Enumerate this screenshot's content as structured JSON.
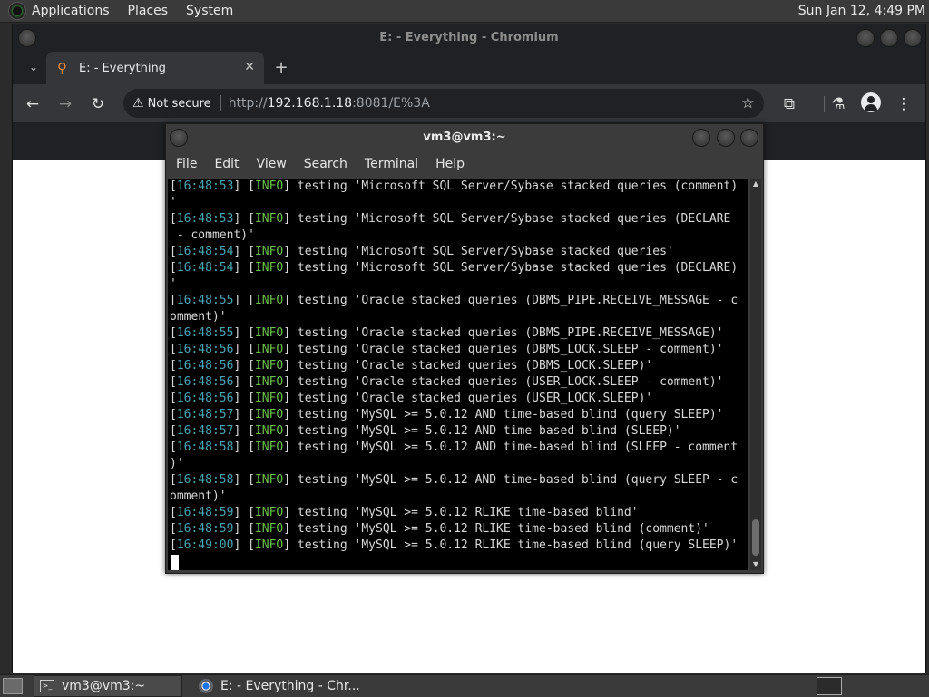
{
  "top_panel": {
    "menus": [
      "Applications",
      "Places",
      "System"
    ],
    "clock": "Sun Jan 12,  4:49 PM"
  },
  "browser": {
    "window_title": "E: - Everything - Chromium",
    "tab_title": "E: - Everything",
    "security_label": "Not secure",
    "url_prefix": "http://",
    "url_host": "192.168.1.18",
    "url_rest": ":8081/E%3A",
    "icons": {
      "tab_list": "chevron-down-icon",
      "favicon": "search-icon",
      "back": "back-arrow-icon",
      "forward": "forward-arrow-icon",
      "reload": "reload-icon",
      "warning": "warning-icon",
      "bookmark": "star-icon",
      "extensions": "puzzle-icon",
      "labs": "flask-icon",
      "profile": "avatar-icon",
      "menu": "kebab-menu-icon"
    }
  },
  "terminal": {
    "title": "vm3@vm3:~",
    "menu": [
      "File",
      "Edit",
      "View",
      "Search",
      "Terminal",
      "Help"
    ],
    "lines": [
      {
        "ts": "16:48:53",
        "lvl": "INFO",
        "msg": " testing 'Microsoft SQL Server/Sybase stacked queries (comment)"
      },
      {
        "ts": "",
        "lvl": "",
        "msg": "'"
      },
      {
        "ts": "16:48:53",
        "lvl": "INFO",
        "msg": " testing 'Microsoft SQL Server/Sybase stacked queries (DECLARE"
      },
      {
        "ts": "",
        "lvl": "",
        "msg": " - comment)'"
      },
      {
        "ts": "16:48:54",
        "lvl": "INFO",
        "msg": " testing 'Microsoft SQL Server/Sybase stacked queries'"
      },
      {
        "ts": "16:48:54",
        "lvl": "INFO",
        "msg": " testing 'Microsoft SQL Server/Sybase stacked queries (DECLARE)"
      },
      {
        "ts": "",
        "lvl": "",
        "msg": "'"
      },
      {
        "ts": "16:48:55",
        "lvl": "INFO",
        "msg": " testing 'Oracle stacked queries (DBMS_PIPE.RECEIVE_MESSAGE - c"
      },
      {
        "ts": "",
        "lvl": "",
        "msg": "omment)'"
      },
      {
        "ts": "16:48:55",
        "lvl": "INFO",
        "msg": " testing 'Oracle stacked queries (DBMS_PIPE.RECEIVE_MESSAGE)'"
      },
      {
        "ts": "16:48:56",
        "lvl": "INFO",
        "msg": " testing 'Oracle stacked queries (DBMS_LOCK.SLEEP - comment)'"
      },
      {
        "ts": "16:48:56",
        "lvl": "INFO",
        "msg": " testing 'Oracle stacked queries (DBMS_LOCK.SLEEP)'"
      },
      {
        "ts": "16:48:56",
        "lvl": "INFO",
        "msg": " testing 'Oracle stacked queries (USER_LOCK.SLEEP - comment)'"
      },
      {
        "ts": "16:48:56",
        "lvl": "INFO",
        "msg": " testing 'Oracle stacked queries (USER_LOCK.SLEEP)'"
      },
      {
        "ts": "16:48:57",
        "lvl": "INFO",
        "msg": " testing 'MySQL >= 5.0.12 AND time-based blind (query SLEEP)'"
      },
      {
        "ts": "16:48:57",
        "lvl": "INFO",
        "msg": " testing 'MySQL >= 5.0.12 AND time-based blind (SLEEP)'"
      },
      {
        "ts": "16:48:58",
        "lvl": "INFO",
        "msg": " testing 'MySQL >= 5.0.12 AND time-based blind (SLEEP - comment"
      },
      {
        "ts": "",
        "lvl": "",
        "msg": ")'"
      },
      {
        "ts": "16:48:58",
        "lvl": "INFO",
        "msg": " testing 'MySQL >= 5.0.12 AND time-based blind (query SLEEP - c"
      },
      {
        "ts": "",
        "lvl": "",
        "msg": "omment)'"
      },
      {
        "ts": "16:48:59",
        "lvl": "INFO",
        "msg": " testing 'MySQL >= 5.0.12 RLIKE time-based blind'"
      },
      {
        "ts": "16:48:59",
        "lvl": "INFO",
        "msg": " testing 'MySQL >= 5.0.12 RLIKE time-based blind (comment)'"
      },
      {
        "ts": "16:49:00",
        "lvl": "INFO",
        "msg": " testing 'MySQL >= 5.0.12 RLIKE time-based blind (query SLEEP)'"
      }
    ],
    "colors": {
      "timestamp": "#4aa5b5",
      "level": "#6cbf4b",
      "text": "#d8d8d8",
      "background": "#000000"
    }
  },
  "taskbar": {
    "tasks": [
      {
        "label": "vm3@vm3:~",
        "icon": "terminal-icon"
      },
      {
        "label": "E: - Everything - Chr...",
        "icon": "chromium-icon"
      }
    ]
  }
}
